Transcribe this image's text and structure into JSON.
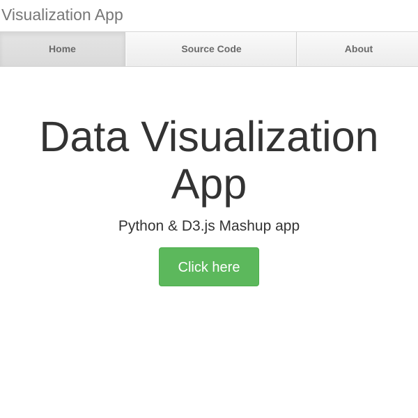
{
  "header": {
    "brand": "Visualization App"
  },
  "nav": {
    "items": [
      {
        "label": "Home",
        "active": true
      },
      {
        "label": "Source Code",
        "active": false
      },
      {
        "label": "About",
        "active": false
      }
    ]
  },
  "hero": {
    "title": "Data Visualization App",
    "subtitle": "Python & D3.js Mashup app",
    "button_label": "Click here"
  },
  "colors": {
    "button_bg": "#5cb85c",
    "text": "#333333",
    "brand_text": "#777777"
  }
}
